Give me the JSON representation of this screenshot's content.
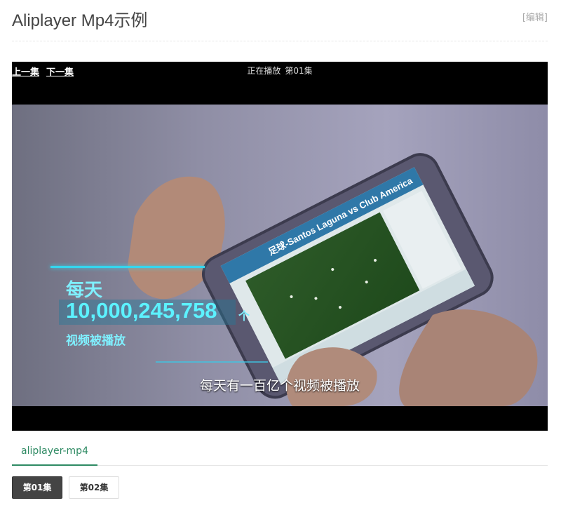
{
  "page": {
    "title": "Aliplayer Mp4示例",
    "edit_link": "[编辑]"
  },
  "player": {
    "prev_label": "上一集",
    "next_label": "下一集",
    "now_playing_label": "正在播放",
    "now_playing_episode": "第01集",
    "overlay": {
      "stat_label": "每天",
      "stat_number": "10,000,245,758",
      "stat_unit": "个",
      "stat_caption": "视频被播放"
    },
    "subtitle": "每天有一百亿个视频被播放",
    "phone_screen_headline": "足球-Santos Laguna vs Club America"
  },
  "tabs": [
    {
      "label": "aliplayer-mp4",
      "active": true
    }
  ],
  "episodes": [
    {
      "label": "第01集",
      "active": true
    },
    {
      "label": "第02集",
      "active": false
    }
  ],
  "colors": {
    "accent": "#2e8a63",
    "overlay_cyan": "#5cf2ff"
  }
}
